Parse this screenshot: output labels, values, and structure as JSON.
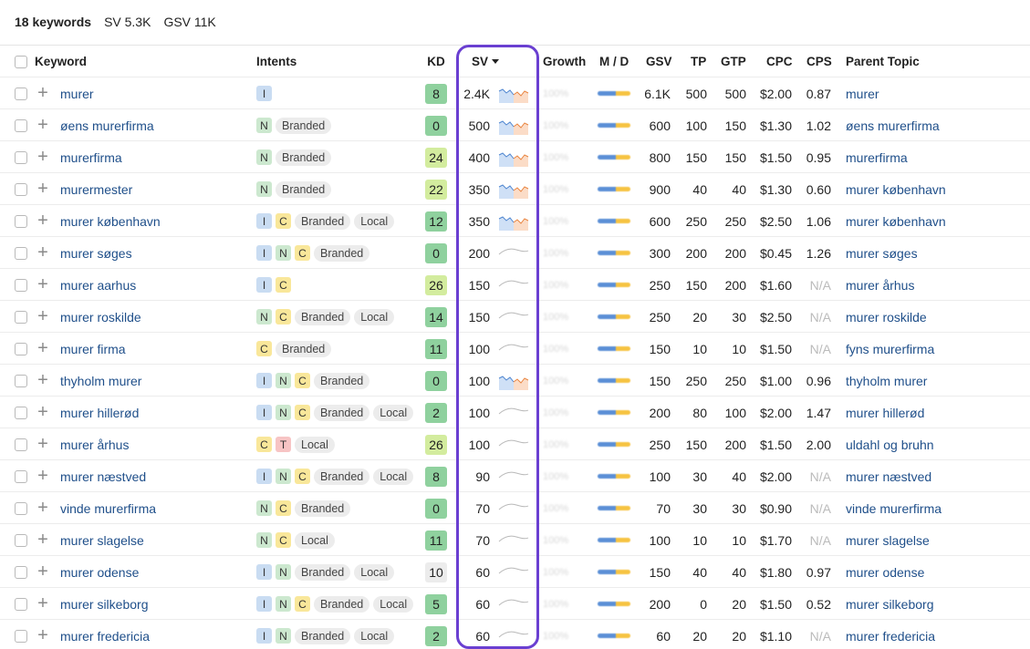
{
  "summary": {
    "keywords": "18 keywords",
    "sv": "SV 5.3K",
    "gsv": "GSV 11K"
  },
  "columns": {
    "keyword": "Keyword",
    "intents": "Intents",
    "kd": "KD",
    "sv": "SV",
    "growth": "Growth",
    "md": "M / D",
    "gsv": "GSV",
    "tp": "TP",
    "gtp": "GTP",
    "cpc": "CPC",
    "cps": "CPS",
    "parent": "Parent Topic"
  },
  "colors": {
    "highlight": "#6a3fd1",
    "link": "#1f4f8a",
    "kd_green": "#8fd19e",
    "kd_light": "#d3ec9e",
    "kd_grey": "#ececec"
  },
  "rows": [
    {
      "keyword": "murer",
      "intents": [
        "I"
      ],
      "tags": [],
      "kd": "8",
      "kd_color": "#8fd19e",
      "sv": "2.4K",
      "trend": "color",
      "growth": "100%",
      "gsv": "6.1K",
      "tp": "500",
      "gtp": "500",
      "cpc": "$2.00",
      "cps": "0.87",
      "parent": "murer"
    },
    {
      "keyword": "øens murerfirma",
      "intents": [
        "N"
      ],
      "tags": [
        "Branded"
      ],
      "kd": "0",
      "kd_color": "#8fd19e",
      "sv": "500",
      "trend": "color",
      "growth": "100%",
      "gsv": "600",
      "tp": "100",
      "gtp": "150",
      "cpc": "$1.30",
      "cps": "1.02",
      "parent": "øens murerfirma"
    },
    {
      "keyword": "murerfirma",
      "intents": [
        "N"
      ],
      "tags": [
        "Branded"
      ],
      "kd": "24",
      "kd_color": "#d3ec9e",
      "sv": "400",
      "trend": "color",
      "growth": "100%",
      "gsv": "800",
      "tp": "150",
      "gtp": "150",
      "cpc": "$1.50",
      "cps": "0.95",
      "parent": "murerfirma"
    },
    {
      "keyword": "murermester",
      "intents": [
        "N"
      ],
      "tags": [
        "Branded"
      ],
      "kd": "22",
      "kd_color": "#d3ec9e",
      "sv": "350",
      "trend": "color",
      "growth": "100%",
      "gsv": "900",
      "tp": "40",
      "gtp": "40",
      "cpc": "$1.30",
      "cps": "0.60",
      "parent": "murer københavn"
    },
    {
      "keyword": "murer københavn",
      "intents": [
        "I",
        "C"
      ],
      "tags": [
        "Branded",
        "Local"
      ],
      "kd": "12",
      "kd_color": "#8fd19e",
      "sv": "350",
      "trend": "color",
      "growth": "100%",
      "gsv": "600",
      "tp": "250",
      "gtp": "250",
      "cpc": "$2.50",
      "cps": "1.06",
      "parent": "murer københavn"
    },
    {
      "keyword": "murer søges",
      "intents": [
        "I",
        "N",
        "C"
      ],
      "tags": [
        "Branded"
      ],
      "kd": "0",
      "kd_color": "#8fd19e",
      "sv": "200",
      "trend": "grey",
      "growth": "100%",
      "gsv": "300",
      "tp": "200",
      "gtp": "200",
      "cpc": "$0.45",
      "cps": "1.26",
      "parent": "murer søges"
    },
    {
      "keyword": "murer aarhus",
      "intents": [
        "I",
        "C"
      ],
      "tags": [],
      "kd": "26",
      "kd_color": "#d3ec9e",
      "sv": "150",
      "trend": "grey",
      "growth": "100%",
      "gsv": "250",
      "tp": "150",
      "gtp": "200",
      "cpc": "$1.60",
      "cps": "N/A",
      "parent": "murer århus"
    },
    {
      "keyword": "murer roskilde",
      "intents": [
        "N",
        "C"
      ],
      "tags": [
        "Branded",
        "Local"
      ],
      "kd": "14",
      "kd_color": "#8fd19e",
      "sv": "150",
      "trend": "grey",
      "growth": "100%",
      "gsv": "250",
      "tp": "20",
      "gtp": "30",
      "cpc": "$2.50",
      "cps": "N/A",
      "parent": "murer roskilde"
    },
    {
      "keyword": "murer firma",
      "intents": [
        "C"
      ],
      "tags": [
        "Branded"
      ],
      "kd": "11",
      "kd_color": "#8fd19e",
      "sv": "100",
      "trend": "grey",
      "growth": "100%",
      "gsv": "150",
      "tp": "10",
      "gtp": "10",
      "cpc": "$1.50",
      "cps": "N/A",
      "parent": "fyns murerfirma"
    },
    {
      "keyword": "thyholm murer",
      "intents": [
        "I",
        "N",
        "C"
      ],
      "tags": [
        "Branded"
      ],
      "kd": "0",
      "kd_color": "#8fd19e",
      "sv": "100",
      "trend": "color",
      "growth": "100%",
      "gsv": "150",
      "tp": "250",
      "gtp": "250",
      "cpc": "$1.00",
      "cps": "0.96",
      "parent": "thyholm murer"
    },
    {
      "keyword": "murer hillerød",
      "intents": [
        "I",
        "N",
        "C"
      ],
      "tags": [
        "Branded",
        "Local"
      ],
      "kd": "2",
      "kd_color": "#8fd19e",
      "sv": "100",
      "trend": "grey",
      "growth": "100%",
      "gsv": "200",
      "tp": "80",
      "gtp": "100",
      "cpc": "$2.00",
      "cps": "1.47",
      "parent": "murer hillerød"
    },
    {
      "keyword": "murer århus",
      "intents": [
        "C",
        "T"
      ],
      "tags": [
        "Local"
      ],
      "kd": "26",
      "kd_color": "#d3ec9e",
      "sv": "100",
      "trend": "grey",
      "growth": "100%",
      "gsv": "250",
      "tp": "150",
      "gtp": "200",
      "cpc": "$1.50",
      "cps": "2.00",
      "parent": "uldahl og bruhn"
    },
    {
      "keyword": "murer næstved",
      "intents": [
        "I",
        "N",
        "C"
      ],
      "tags": [
        "Branded",
        "Local"
      ],
      "kd": "8",
      "kd_color": "#8fd19e",
      "sv": "90",
      "trend": "grey",
      "growth": "100%",
      "gsv": "100",
      "tp": "30",
      "gtp": "40",
      "cpc": "$2.00",
      "cps": "N/A",
      "parent": "murer næstved"
    },
    {
      "keyword": "vinde murerfirma",
      "intents": [
        "N",
        "C"
      ],
      "tags": [
        "Branded"
      ],
      "kd": "0",
      "kd_color": "#8fd19e",
      "sv": "70",
      "trend": "grey",
      "growth": "100%",
      "gsv": "70",
      "tp": "30",
      "gtp": "30",
      "cpc": "$0.90",
      "cps": "N/A",
      "parent": "vinde murerfirma"
    },
    {
      "keyword": "murer slagelse",
      "intents": [
        "N",
        "C"
      ],
      "tags": [
        "Local"
      ],
      "kd": "11",
      "kd_color": "#8fd19e",
      "sv": "70",
      "trend": "grey",
      "growth": "100%",
      "gsv": "100",
      "tp": "10",
      "gtp": "10",
      "cpc": "$1.70",
      "cps": "N/A",
      "parent": "murer slagelse"
    },
    {
      "keyword": "murer odense",
      "intents": [
        "I",
        "N"
      ],
      "tags": [
        "Branded",
        "Local"
      ],
      "kd": "10",
      "kd_color": "#ececec",
      "sv": "60",
      "trend": "grey",
      "growth": "100%",
      "gsv": "150",
      "tp": "40",
      "gtp": "40",
      "cpc": "$1.80",
      "cps": "0.97",
      "parent": "murer odense"
    },
    {
      "keyword": "murer silkeborg",
      "intents": [
        "I",
        "N",
        "C"
      ],
      "tags": [
        "Branded",
        "Local"
      ],
      "kd": "5",
      "kd_color": "#8fd19e",
      "sv": "60",
      "trend": "grey",
      "growth": "100%",
      "gsv": "200",
      "tp": "0",
      "gtp": "20",
      "cpc": "$1.50",
      "cps": "0.52",
      "parent": "murer silkeborg"
    },
    {
      "keyword": "murer fredericia",
      "intents": [
        "I",
        "N"
      ],
      "tags": [
        "Branded",
        "Local"
      ],
      "kd": "2",
      "kd_color": "#8fd19e",
      "sv": "60",
      "trend": "grey",
      "growth": "100%",
      "gsv": "60",
      "tp": "20",
      "gtp": "20",
      "cpc": "$1.10",
      "cps": "N/A",
      "parent": "murer fredericia"
    }
  ]
}
